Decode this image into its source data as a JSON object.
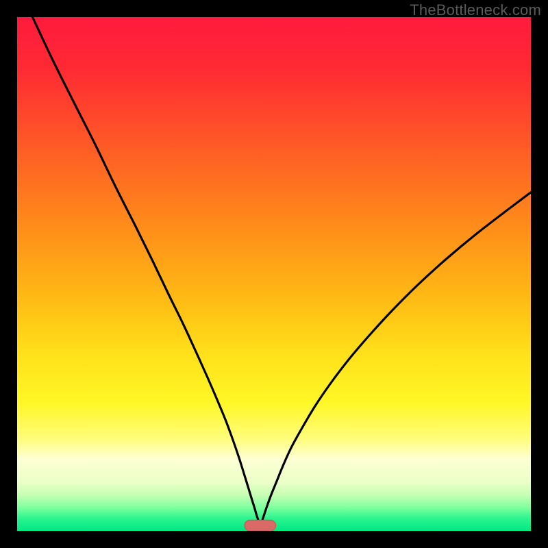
{
  "watermark": "TheBottleneck.com",
  "colors": {
    "frame": "#000000",
    "curve": "#000000",
    "marker_fill": "#d96a66",
    "marker_stroke": "#c95550",
    "gradient_stops": [
      {
        "offset": 0.0,
        "color": "#ff1a3d"
      },
      {
        "offset": 0.1,
        "color": "#ff2a33"
      },
      {
        "offset": 0.25,
        "color": "#ff5a26"
      },
      {
        "offset": 0.4,
        "color": "#ff8a1a"
      },
      {
        "offset": 0.55,
        "color": "#ffbb14"
      },
      {
        "offset": 0.66,
        "color": "#ffe21a"
      },
      {
        "offset": 0.75,
        "color": "#fff726"
      },
      {
        "offset": 0.82,
        "color": "#fffd7a"
      },
      {
        "offset": 0.86,
        "color": "#fdffd4"
      },
      {
        "offset": 0.905,
        "color": "#ecffc8"
      },
      {
        "offset": 0.93,
        "color": "#c6ffb3"
      },
      {
        "offset": 0.955,
        "color": "#7dff9e"
      },
      {
        "offset": 0.975,
        "color": "#2df58f"
      },
      {
        "offset": 1.0,
        "color": "#00e884"
      }
    ]
  },
  "chart_data": {
    "type": "line",
    "title": "",
    "xlabel": "",
    "ylabel": "",
    "xlim": [
      0,
      100
    ],
    "ylim": [
      0,
      100
    ],
    "grid": false,
    "legend": false,
    "marker": {
      "x": 47.3,
      "width": 6.1,
      "height": 2.1
    },
    "series": [
      {
        "name": "left-branch",
        "x": [
          3.0,
          6.9,
          11.1,
          15.3,
          19.3,
          23.0,
          26.4,
          29.5,
          32.3,
          34.7,
          37.0,
          38.9,
          40.6,
          42.0,
          43.2,
          44.2,
          45.0,
          45.7,
          46.2,
          46.6,
          46.9,
          47.2,
          47.3
        ],
        "y": [
          100.0,
          91.7,
          83.3,
          75.0,
          66.7,
          59.4,
          52.5,
          46.0,
          40.3,
          35.1,
          30.0,
          25.6,
          21.5,
          17.7,
          14.2,
          11.0,
          8.4,
          6.1,
          4.5,
          3.1,
          2.2,
          1.4,
          1.0
        ]
      },
      {
        "name": "right-branch",
        "x": [
          47.3,
          47.6,
          48.0,
          48.6,
          49.4,
          50.5,
          51.8,
          53.4,
          55.5,
          58.0,
          61.0,
          64.5,
          68.5,
          73.0,
          78.0,
          83.5,
          89.5,
          96.0,
          100.0
        ],
        "y": [
          1.0,
          1.7,
          2.9,
          4.7,
          6.9,
          9.6,
          12.8,
          16.3,
          20.1,
          24.3,
          28.7,
          33.3,
          38.0,
          42.9,
          47.9,
          52.9,
          57.9,
          62.9,
          65.9
        ]
      }
    ]
  }
}
